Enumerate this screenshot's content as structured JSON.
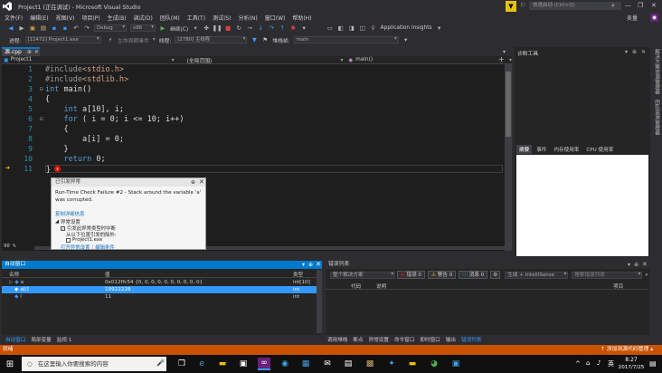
{
  "title": {
    "text": "Project1 (正在调试) - Microsoft Visual Studio",
    "quick_launch": "快速启动 (Ctrl+Q)"
  },
  "menu": [
    "文件(F)",
    "编辑(E)",
    "视图(V)",
    "项目(P)",
    "生成(B)",
    "调试(D)",
    "团队(M)",
    "工具(T)",
    "测试(S)",
    "分析(N)",
    "窗口(W)",
    "帮助(H)"
  ],
  "user": "吴量",
  "toolbar1": {
    "config": "Debug",
    "platform": "x86",
    "continue": "继续(C)",
    "app_insights": "Application Insights"
  },
  "toolbar2": {
    "process_label": "进程:",
    "process_value": "[11472] Project1.exe",
    "lifecycle": "生命周期事件",
    "thread_label": "线程:",
    "thread_value": "[2780] 主线程",
    "stack_label": "堆栈帧:",
    "stack_value": "main"
  },
  "editor": {
    "tab": "源.cpp",
    "project": "Project1",
    "scope": "(全局范围)",
    "function": "main()",
    "zoom": "90 %",
    "lines": [
      "1",
      "2",
      "3",
      "4",
      "5",
      "6",
      "7",
      "8",
      "9",
      "10",
      "11"
    ]
  },
  "exception": {
    "header": "已引发异常",
    "message": "Run-Time Check Failure #2 - Stack around the variable 'a' was corrupted.",
    "copy_details": "复制详细信息",
    "settings": "异常设置",
    "break_when": "引发此异常类型时中断",
    "except_from": "从以下位置引发的除外:",
    "module": "Project1.exe",
    "open_settings": "打开异常设置",
    "edit_condition": "编辑条件"
  },
  "diag": {
    "title": "诊断工具",
    "tabs": [
      "摘要",
      "事件",
      "内存使用率",
      "CPU 使用率"
    ]
  },
  "rail": [
    "解决方案资源管理器",
    "团队资源管理器"
  ],
  "autos": {
    "title": "自动窗口",
    "columns": [
      "名称",
      "值",
      "类型"
    ],
    "rows": [
      {
        "name": "a",
        "value": "0x012ffc54 {0, 0, 0, 0, 0, 0, 0, 0, 0, 0}",
        "type": "int[10]"
      },
      {
        "name": "a[i]",
        "value": "19922228",
        "type": "int"
      },
      {
        "name": "i",
        "value": "11",
        "type": "int"
      }
    ],
    "bottom_tabs": [
      "自动窗口",
      "局部变量",
      "监视 1"
    ]
  },
  "errors": {
    "title": "错误列表",
    "scope": "整个解决方案",
    "errors": "错误 0",
    "warnings": "警告 0",
    "messages": "消息 0",
    "build": "生成 + IntelliSense",
    "search": "搜索错误列表",
    "columns": [
      "代码",
      "说明",
      "项目"
    ],
    "bottom_tabs": [
      "调用堆栈",
      "断点",
      "异常设置",
      "命令窗口",
      "即时窗口",
      "输出",
      "错误列表"
    ]
  },
  "status": {
    "text": "就绪",
    "source_control": "添加到源代码管理"
  },
  "taskbar": {
    "search": "在这里输入你要搜索的内容",
    "time": "8:27",
    "date": "2017/7/25",
    "ime": "英"
  }
}
